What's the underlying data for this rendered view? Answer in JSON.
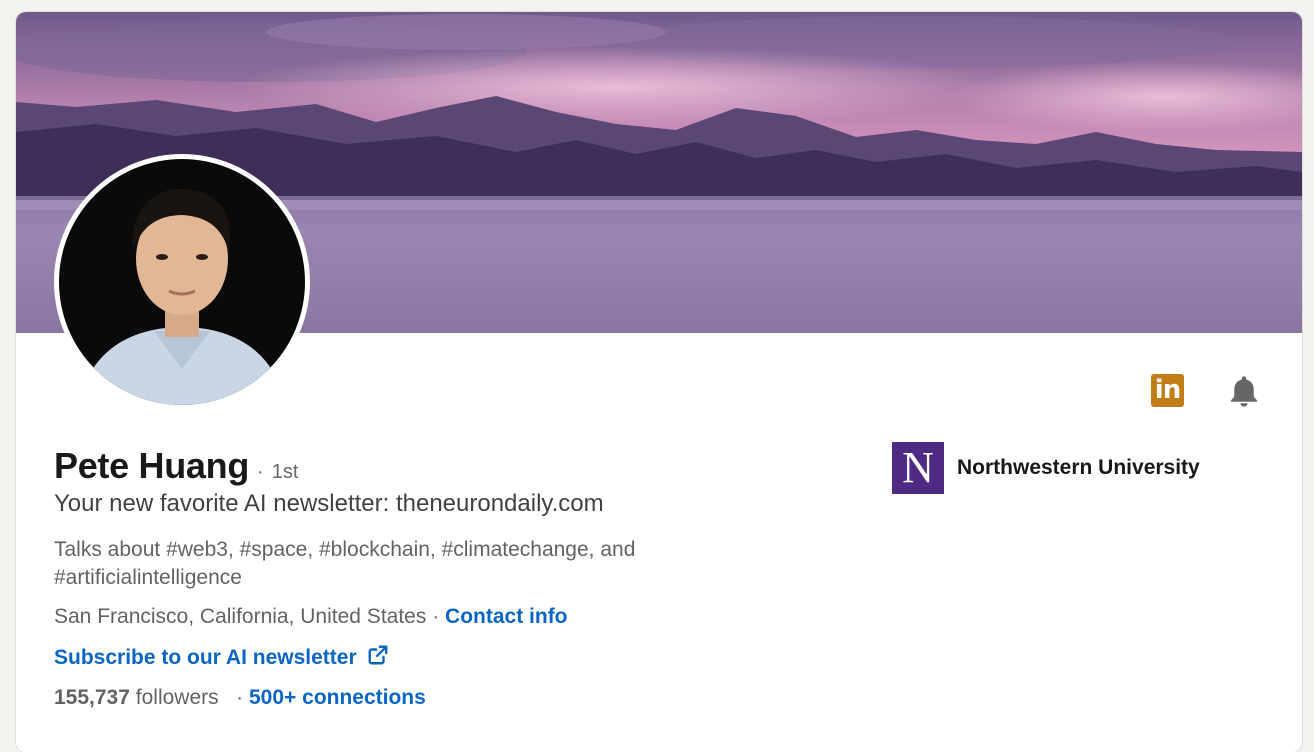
{
  "profile": {
    "name": "Pete Huang",
    "degree": "1st",
    "degree_separator": "·",
    "headline": "Your new favorite AI newsletter: theneurondaily.com",
    "talks_about": "Talks about #web3, #space, #blockchain, #climatechange, and #artificialintelligence",
    "location": "San Francisco, California, United States",
    "location_separator": "·",
    "contact_info_label": "Contact info",
    "custom_button_label": "Subscribe to our AI newsletter",
    "followers_count": "155,737",
    "followers_label": "followers",
    "connections_separator": "·",
    "connections_label": "500+ connections"
  },
  "education": {
    "logo_letter": "N",
    "name": "Northwestern University"
  },
  "icons": {
    "linkedin": "in",
    "bell": "bell-icon",
    "external_link": "external-link-icon"
  },
  "colors": {
    "link_blue": "#0a66c2",
    "linkedin_badge": "#c37d16",
    "northwestern_purple": "#4e2a84",
    "page_background": "#f3f2ef"
  }
}
